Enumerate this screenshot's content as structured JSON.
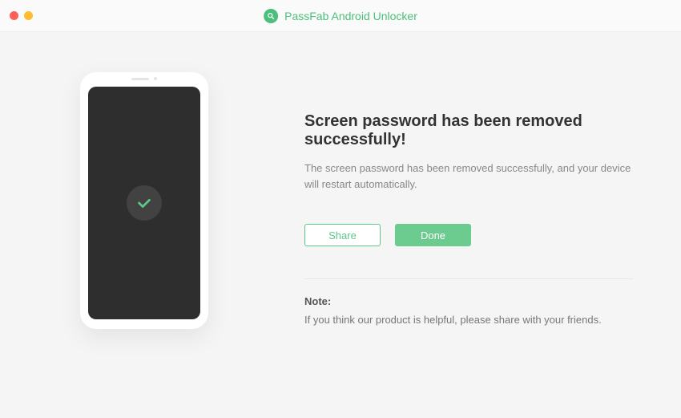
{
  "app": {
    "title": "PassFab Android Unlocker"
  },
  "main": {
    "heading": "Screen password has been removed successfully!",
    "subtext": "The screen password has been removed successfully, and your device will restart automatically."
  },
  "buttons": {
    "share": "Share",
    "done": "Done"
  },
  "note": {
    "label": "Note:",
    "text": "If you think our product is helpful, please share with your friends."
  }
}
